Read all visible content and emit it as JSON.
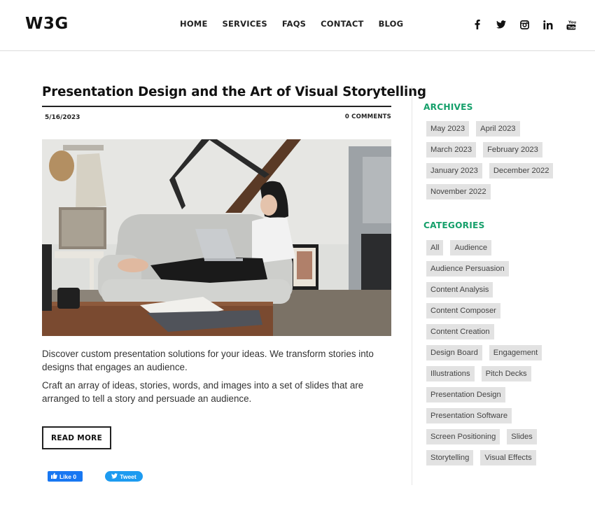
{
  "header": {
    "logo": "W3G",
    "nav": [
      "HOME",
      "SERVICES",
      "FAQS",
      "CONTACT",
      "BLOG"
    ],
    "social": [
      {
        "name": "facebook-icon"
      },
      {
        "name": "twitter-icon"
      },
      {
        "name": "instagram-icon"
      },
      {
        "name": "linkedin-icon"
      },
      {
        "name": "youtube-icon"
      }
    ]
  },
  "post": {
    "title": "Presentation Design and the Art of Visual Storytelling",
    "date": "5/16/2023",
    "comments": "0 COMMENTS",
    "image_alt": "Woman working on a laptop while sitting on a grey sofa",
    "paragraphs": [
      "Discover custom presentation solutions for your ideas. We transform stories into designs that engages an audience.",
      "Craft an array of ideas, stories, words, and images into a set of slides that are arranged to tell a story and persuade an audience."
    ],
    "read_more": "READ MORE",
    "fb_like": "Like 0",
    "tweet": "Tweet"
  },
  "sidebar": {
    "archives_heading": "ARCHIVES",
    "archives": [
      "May 2023",
      "April 2023",
      "March 2023",
      "February 2023",
      "January 2023",
      "December 2022",
      "November 2022"
    ],
    "categories_heading": "CATEGORIES",
    "categories": [
      "All",
      "Audience",
      "Audience Persuasion",
      "Content Analysis",
      "Content Composer",
      "Content Creation",
      "Design Board",
      "Engagement",
      "Illustrations",
      "Pitch Decks",
      "Presentation Design",
      "Presentation Software",
      "Screen Positioning",
      "Slides",
      "Storytelling",
      "Visual Effects"
    ]
  },
  "colors": {
    "accent_green": "#16a06b",
    "tag_bg": "#e2e2e2",
    "facebook_blue": "#1877f2",
    "twitter_blue": "#1d9bf0"
  }
}
